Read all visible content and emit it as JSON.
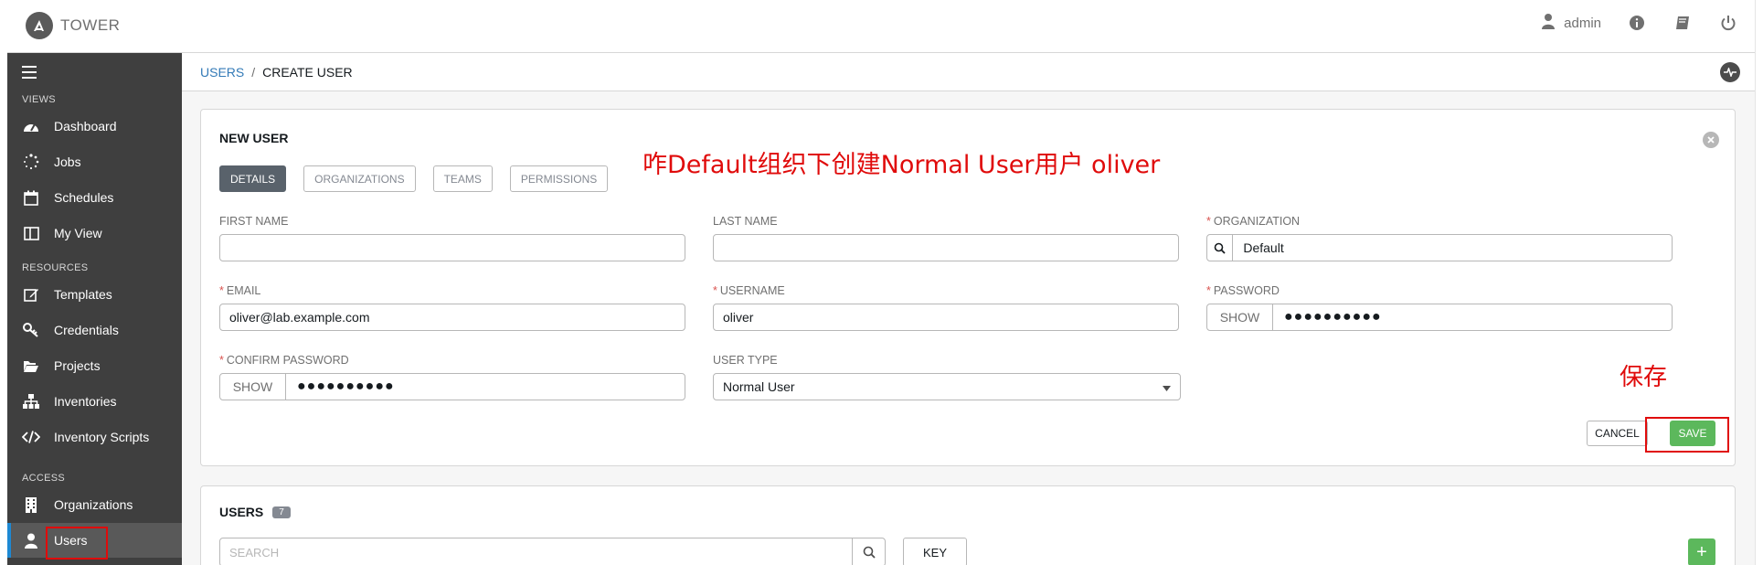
{
  "app": {
    "name": "TOWER"
  },
  "header": {
    "user_label": "admin"
  },
  "sidebar": {
    "sections": {
      "views": "VIEWS",
      "resources": "RESOURCES",
      "access": "ACCESS"
    },
    "items": [
      {
        "label": "Dashboard"
      },
      {
        "label": "Jobs"
      },
      {
        "label": "Schedules"
      },
      {
        "label": "My View"
      },
      {
        "label": "Templates"
      },
      {
        "label": "Credentials"
      },
      {
        "label": "Projects"
      },
      {
        "label": "Inventories"
      },
      {
        "label": "Inventory Scripts"
      },
      {
        "label": "Organizations"
      },
      {
        "label": "Users"
      }
    ]
  },
  "breadcrumb": {
    "parent": "USERS",
    "separator": "/",
    "current": "CREATE USER"
  },
  "form": {
    "title": "NEW USER",
    "tabs": [
      "DETAILS",
      "ORGANIZATIONS",
      "TEAMS",
      "PERMISSIONS"
    ],
    "first_name": {
      "label": "FIRST NAME",
      "value": ""
    },
    "last_name": {
      "label": "LAST NAME",
      "value": ""
    },
    "organization": {
      "label": "ORGANIZATION",
      "value": "Default"
    },
    "email": {
      "label": "EMAIL",
      "value": "oliver@lab.example.com"
    },
    "username": {
      "label": "USERNAME",
      "value": "oliver"
    },
    "password": {
      "label": "PASSWORD",
      "show": "SHOW",
      "masked": "●●●●●●●●●●"
    },
    "confirm_password": {
      "label": "CONFIRM PASSWORD",
      "show": "SHOW",
      "masked": "●●●●●●●●●●"
    },
    "user_type": {
      "label": "USER TYPE",
      "value": "Normal User"
    },
    "cancel_label": "CANCEL",
    "save_label": "SAVE"
  },
  "annotations": {
    "main": "咋Default组织下创建Normal User用户   oliver",
    "save": "保存"
  },
  "users_panel": {
    "title": "USERS",
    "count": "7",
    "search_placeholder": "SEARCH",
    "key_label": "KEY",
    "add_label": "+"
  },
  "colors": {
    "accent": "#1d89d4",
    "save_green": "#5cb85c",
    "annotation_red": "#e00b0b",
    "sidebar_bg": "#3f3f3f"
  }
}
